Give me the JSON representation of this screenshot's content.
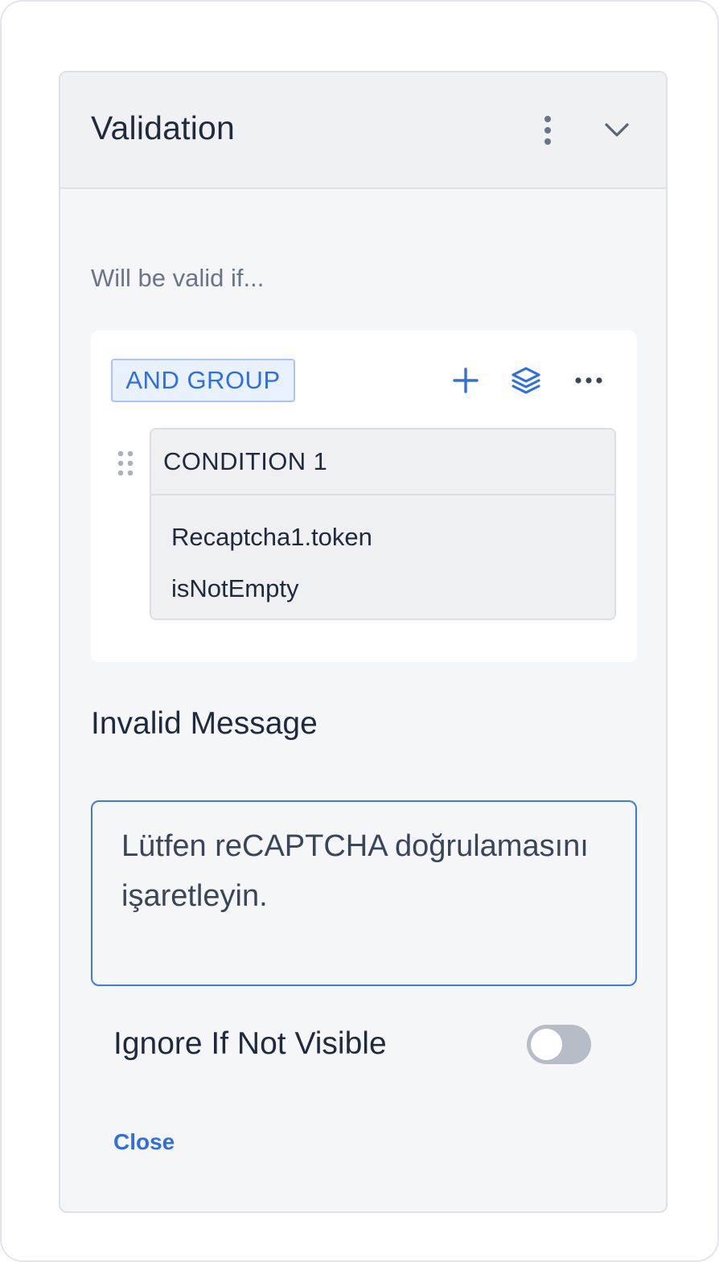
{
  "panel": {
    "title": "Validation",
    "icons": {
      "menu": "kebab-vertical-icon",
      "collapse": "chevron-down-icon"
    }
  },
  "rules": {
    "label": "Will be valid if...",
    "group": {
      "badge": "AND GROUP",
      "icons": {
        "add": "plus-icon",
        "layers": "layers-icon",
        "more": "more-horizontal-icon",
        "drag": "drag-handle-icon"
      },
      "condition": {
        "title": "CONDITION 1",
        "field": "Recaptcha1.token",
        "operator": "isNotEmpty"
      }
    }
  },
  "invalid_message": {
    "label": "Invalid Message",
    "value": "Lütfen reCAPTCHA doğrulamasını işaretleyin."
  },
  "ignore_if_not_visible": {
    "label": "Ignore If Not Visible",
    "enabled": false
  },
  "actions": {
    "close_label": "Close"
  },
  "colors": {
    "accent": "#2f6fe4",
    "text": "#1f2a3c",
    "muted": "#6b7588",
    "toggle_off": "#b7bdc6"
  }
}
